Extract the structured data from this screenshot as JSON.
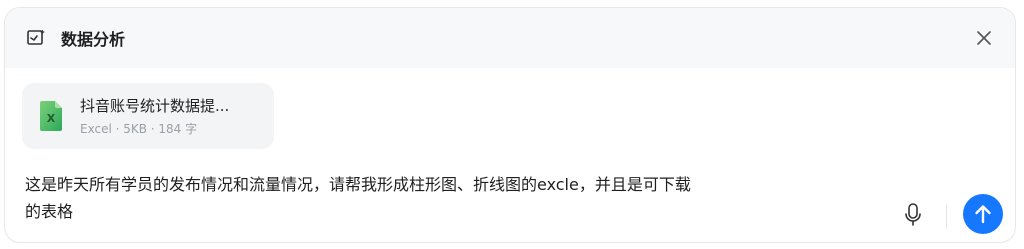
{
  "header": {
    "title": "数据分析",
    "mode_icon": "chart-mode-icon",
    "close_icon": "close-icon"
  },
  "attachment": {
    "file_name": "抖音账号统计数据提...",
    "file_info": "Excel · 5KB · 184 字",
    "file_icon": "excel-file-icon",
    "file_icon_color": "#3cb371",
    "file_icon_letter": "X"
  },
  "composer": {
    "message": "这是昨天所有学员的发布情况和流量情况，请帮我形成柱形图、折线图的excle，并且是可下载\n的表格",
    "mic_icon": "microphone-icon",
    "send_icon": "arrow-up-icon",
    "send_color": "#1677ff"
  }
}
